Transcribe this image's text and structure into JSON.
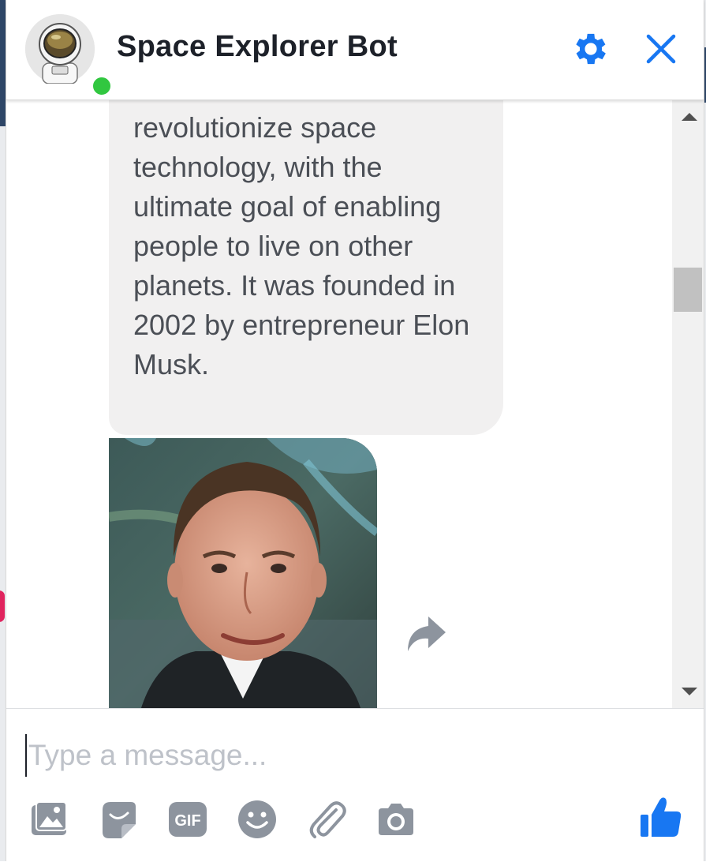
{
  "header": {
    "title": "Space Explorer Bot",
    "online_status_color": "#31c740",
    "settings_icon": "gear-icon",
    "close_icon": "close-icon"
  },
  "messages": [
    {
      "type": "text",
      "from": "bot",
      "text": "revolutionize space technology, with the ultimate goal of enabling people to live on other planets. It was founded in 2002 by entrepreneur Elon Musk."
    },
    {
      "type": "image",
      "from": "bot",
      "share_icon": "share-icon"
    }
  ],
  "composer": {
    "placeholder": "Type a message...",
    "value": "",
    "tools": [
      "photo-icon",
      "sticker-icon",
      "gif-icon",
      "emoji-icon",
      "attachment-icon",
      "camera-icon"
    ],
    "gif_label": "GIF",
    "send_icon": "thumbs-up-icon"
  },
  "colors": {
    "accent": "#1877f2",
    "tool_gray": "#8d949e",
    "bubble_bg": "#f1f0f0",
    "text": "#1d2129"
  }
}
